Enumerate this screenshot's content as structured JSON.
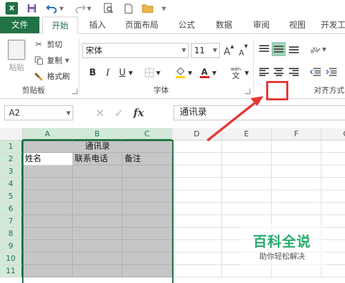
{
  "qat": {
    "app_logo": "X",
    "icons": [
      "save-icon",
      "undo-icon",
      "redo-icon",
      "print-preview-icon",
      "new-file-icon",
      "open-folder-icon",
      "customize-toolbar-icon"
    ]
  },
  "tabs": [
    {
      "label": "文件"
    },
    {
      "label": "开始"
    },
    {
      "label": "插入"
    },
    {
      "label": "页面布局"
    },
    {
      "label": "公式"
    },
    {
      "label": "数据"
    },
    {
      "label": "审阅"
    },
    {
      "label": "视图"
    },
    {
      "label": "开发工"
    }
  ],
  "clipboard": {
    "paste_label": "粘贴",
    "cut_label": "剪切",
    "copy_label": "复制",
    "format_painter_label": "格式刷",
    "group_label": "剪贴板"
  },
  "font": {
    "font_name": "宋体",
    "font_size": "11",
    "bold": "B",
    "italic": "I",
    "underline": "U",
    "wen_label": "wén",
    "wen_char": "文",
    "grow": "A",
    "shrink": "A",
    "group_label": "字体"
  },
  "alignment": {
    "group_label": "对齐方式"
  },
  "formula_bar": {
    "name_box": "A2",
    "cancel_icon": "✕",
    "enter_icon": "✓",
    "fx_label": "fx",
    "content": "通讯录"
  },
  "sheet": {
    "columns": [
      "A",
      "B",
      "C",
      "D",
      "E",
      "F",
      "G"
    ],
    "rows": [
      "1",
      "2",
      "3",
      "4",
      "5",
      "6",
      "7",
      "8",
      "9",
      "10",
      "11"
    ],
    "merged_title": "通讯录",
    "row2": [
      "姓名",
      "联系电话",
      "备注"
    ]
  },
  "watermark": {
    "title": "百科全说",
    "subtitle": "助你轻松解决"
  },
  "colors": {
    "excel_green": "#217346",
    "selection_fill": "#c6c6c6",
    "annotation_red": "#e53935"
  }
}
